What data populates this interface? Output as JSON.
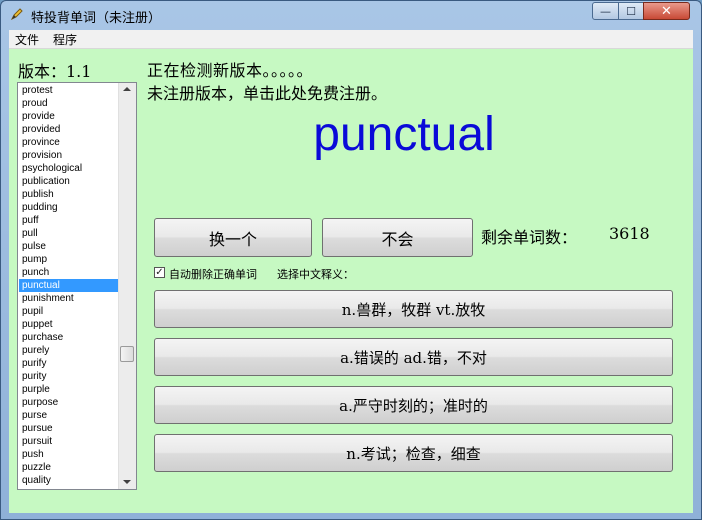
{
  "window": {
    "title": "特投背单词（未注册）",
    "controls": {
      "minimize": "—",
      "maximize": "☐",
      "close": "✕"
    }
  },
  "menu": [
    "文件",
    "程序"
  ],
  "version_label": "版本：1.1",
  "status_checking": "正在检测新版本。。。。。",
  "status_register": "未注册版本，单击此处免费注册。",
  "word_list": [
    "protest",
    "proud",
    "provide",
    "provided",
    "province",
    "provision",
    "psychological",
    "publication",
    "publish",
    "pudding",
    "puff",
    "pull",
    "pulse",
    "pump",
    "punch",
    "punctual",
    "punishment",
    "pupil",
    "puppet",
    "purchase",
    "purely",
    "purify",
    "purity",
    "purple",
    "purpose",
    "purse",
    "pursue",
    "pursuit",
    "push",
    "puzzle",
    "quality"
  ],
  "selected_index": 15,
  "current_word": "punctual",
  "buttons": {
    "swap": "换一个",
    "dont_know": "不会"
  },
  "remaining_label": "剩余单词数：",
  "remaining_count": "3618",
  "auto_delete_label": "自动删除正确单词",
  "auto_delete_checked": true,
  "choose_label": "选择中文释义：",
  "options": [
    "n.兽群，牧群 vt.放牧",
    "a.错误的 ad.错，不对",
    "a.严守时刻的；准时的",
    "n.考试；检查，细查"
  ],
  "colors": {
    "client_bg": "#c6f9c2",
    "word": "#0a0ad8",
    "selection": "#3399ff"
  }
}
